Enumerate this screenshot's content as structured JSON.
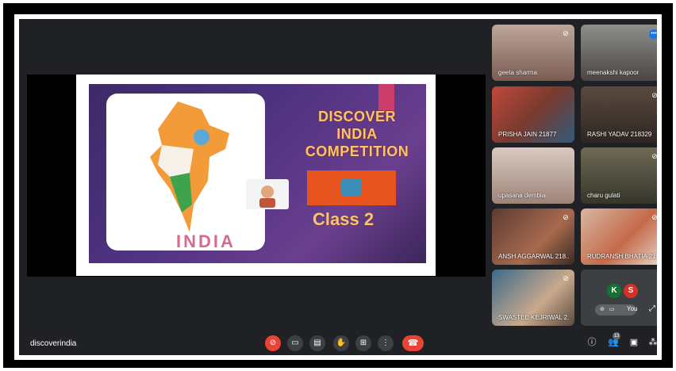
{
  "meeting": {
    "code": "discoverindia"
  },
  "presentation": {
    "title_lines": [
      "DISCOVER",
      "INDIA",
      "COMPETITION"
    ],
    "class_label": "Class  2",
    "map_word": "INDIA"
  },
  "participants": [
    {
      "name": "geeta sharma",
      "muted": true,
      "speaking": false
    },
    {
      "name": "meenakshi kapoor",
      "muted": false,
      "speaking": true
    },
    {
      "name": "PRISHA JAIN 21877",
      "muted": false,
      "speaking": false
    },
    {
      "name": "RASHI YADAV 218329",
      "muted": true,
      "speaking": false
    },
    {
      "name": "upasana dembla",
      "muted": false,
      "speaking": false
    },
    {
      "name": "charu gulati",
      "muted": true,
      "speaking": false
    },
    {
      "name": "ANSH AGGARWAL 218...",
      "muted": true,
      "speaking": false
    },
    {
      "name": "RUDRANSH BHATIA 21...",
      "muted": true,
      "speaking": false
    },
    {
      "name": "SWASTEE KEJRIWAL 2...",
      "muted": true,
      "speaking": false
    }
  ],
  "self_tile": {
    "avatars": [
      {
        "letter": "K",
        "color": "#137333"
      },
      {
        "letter": "S",
        "color": "#d93025"
      }
    ],
    "label": "You"
  },
  "toolbar": {
    "mic_icon": "mic-off-icon",
    "people_count": "13"
  },
  "colors": {
    "background": "#202124",
    "danger": "#ea4335",
    "accent": "#1a73e8"
  }
}
